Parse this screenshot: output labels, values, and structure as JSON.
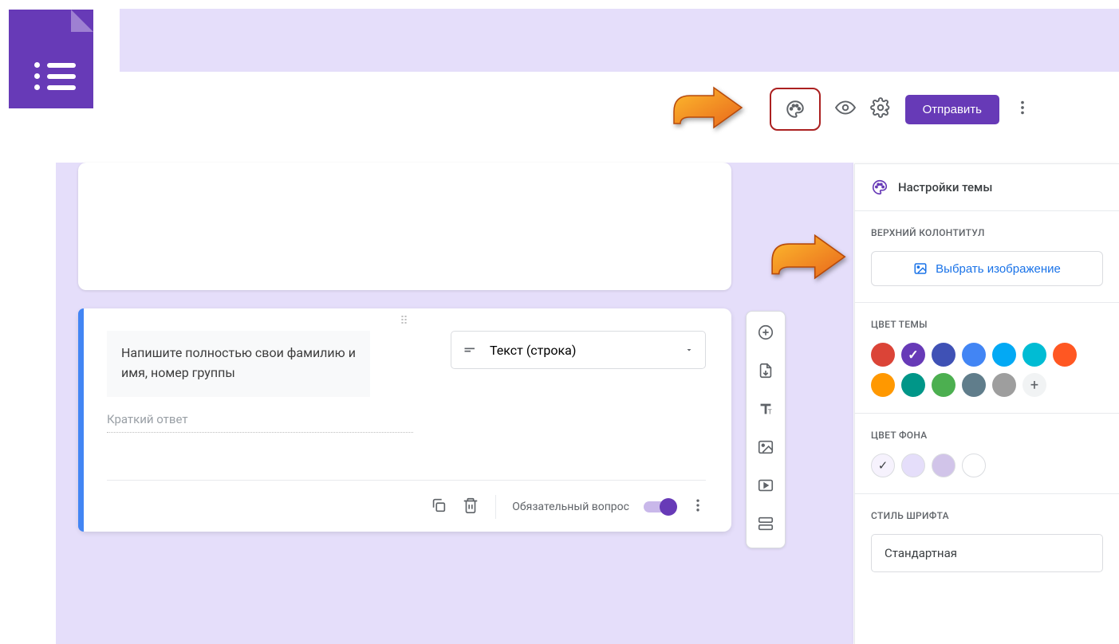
{
  "header": {
    "send_label": "Отправить"
  },
  "question": {
    "text": "Напишите полностью свои фамилию и имя, номер группы",
    "short_answer_placeholder": "Краткий ответ",
    "type_label": "Текст (строка)",
    "required_label": "Обязательный вопрос"
  },
  "theme_panel": {
    "title": "Настройки темы",
    "header_section_label": "ВЕРХНИЙ КОЛОНТИТУЛ",
    "choose_image_label": "Выбрать изображение",
    "theme_color_label": "ЦВЕТ ТЕМЫ",
    "theme_colors": [
      "#db4437",
      "#673ab7",
      "#3f51b5",
      "#4285f4",
      "#03a9f4",
      "#00bcd4",
      "#ff5722",
      "#ff9800",
      "#009688",
      "#4caf50",
      "#607d8b",
      "#9e9e9e"
    ],
    "selected_theme_color_index": 1,
    "bg_color_label": "ЦВЕТ ФОНА",
    "bg_colors": [
      "#f6f2fd",
      "#e5defa",
      "#d1c4e9",
      "#ffffff"
    ],
    "selected_bg_color_index": 0,
    "font_style_label": "СТИЛЬ ШРИФТА",
    "font_value": "Стандартная"
  }
}
